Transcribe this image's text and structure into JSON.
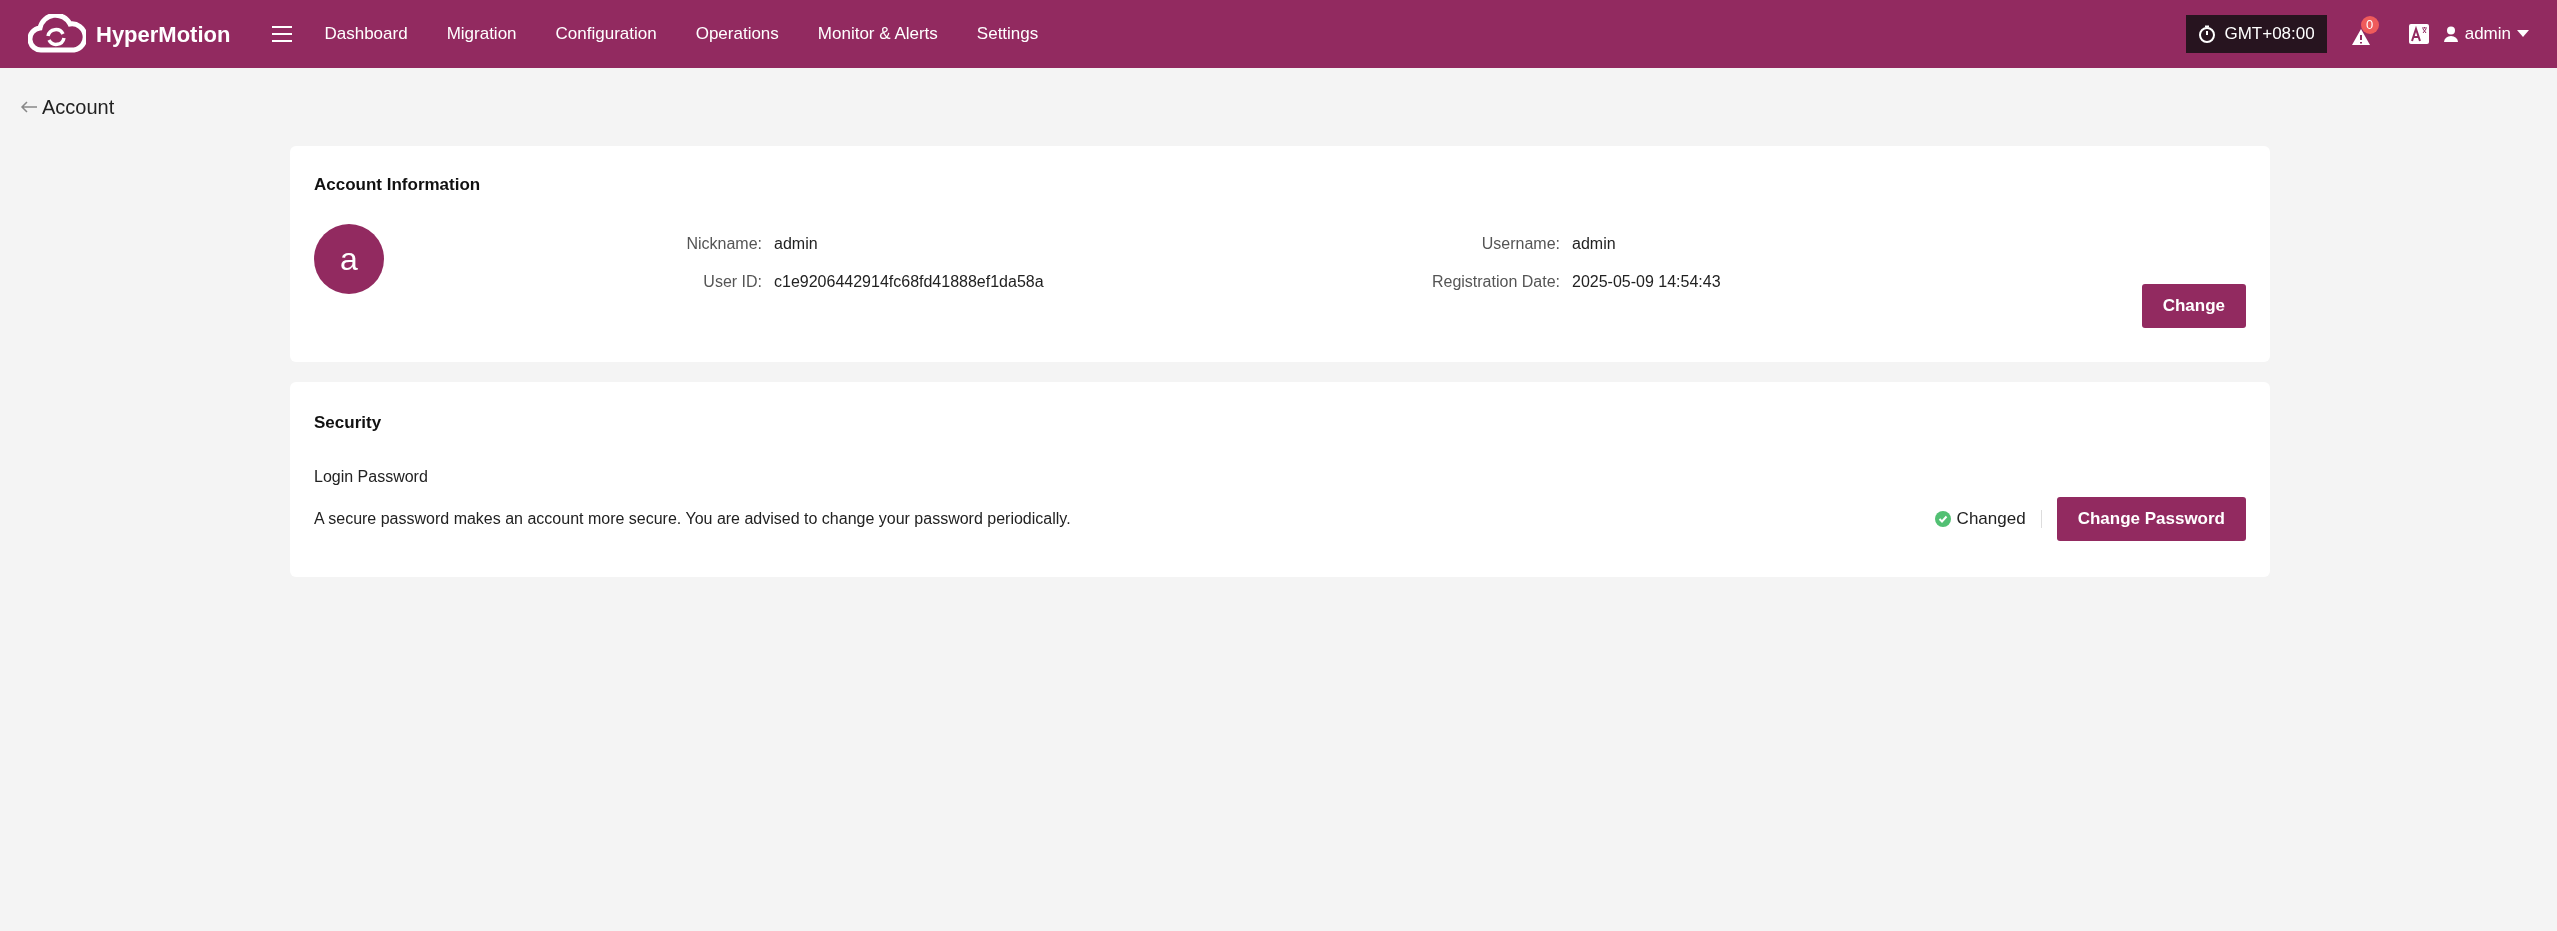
{
  "header": {
    "brand": "HyperMotion",
    "nav": [
      {
        "label": "Dashboard"
      },
      {
        "label": "Migration"
      },
      {
        "label": "Configuration"
      },
      {
        "label": "Operations"
      },
      {
        "label": "Monitor & Alerts"
      },
      {
        "label": "Settings"
      }
    ],
    "timezone": "GMT+08:00",
    "alert_count": "0",
    "user": "admin"
  },
  "page_title": "Account",
  "account": {
    "title": "Account Information",
    "avatar_letter": "a",
    "fields": [
      {
        "label": "Nickname:",
        "value": "admin"
      },
      {
        "label": "Username:",
        "value": "admin"
      },
      {
        "label": "User ID:",
        "value": "c1e9206442914fc68fd41888ef1da58a"
      },
      {
        "label": "Registration Date:",
        "value": "2025-05-09 14:54:43"
      }
    ],
    "button": "Change"
  },
  "security": {
    "title": "Security",
    "item_title": "Login Password",
    "description": "A secure password makes an account more secure. You are advised to change your password periodically.",
    "status": "Changed",
    "button": "Change Password"
  }
}
